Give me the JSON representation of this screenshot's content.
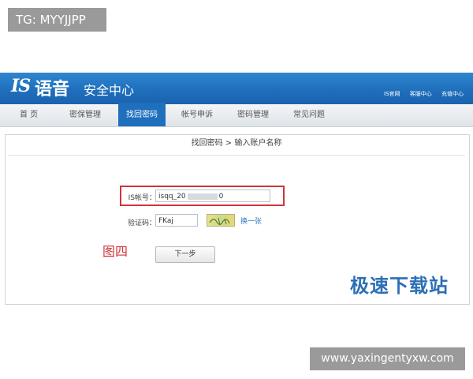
{
  "watermark_top": "TG: MYYJJPP",
  "watermark_bottom": "www.yaxingentyxw.com",
  "header": {
    "logo_is": "IS",
    "logo_cn": "语音",
    "subtitle": "安全中心",
    "links": [
      "IS官网",
      "客服中心",
      "充值中心"
    ]
  },
  "nav": [
    "首 页",
    "密保管理",
    "找回密码",
    "帐号申诉",
    "密码管理",
    "常见问题"
  ],
  "nav_active_index": 2,
  "breadcrumb": "找回密码 > 输入账户名称",
  "form": {
    "account_label": "IS帐号：",
    "account_value_start": "isqq_20",
    "account_value_end": "0",
    "captcha_label": "验证码：",
    "captcha_value": "FKaj",
    "refresh_link": "换一张",
    "next_button": "下一步"
  },
  "annotation": "图四",
  "brand_watermark": "极速下载站",
  "colors": {
    "header_blue": "#1f6fbd",
    "highlight_red": "#d0343a",
    "link_blue": "#2b78c5"
  }
}
